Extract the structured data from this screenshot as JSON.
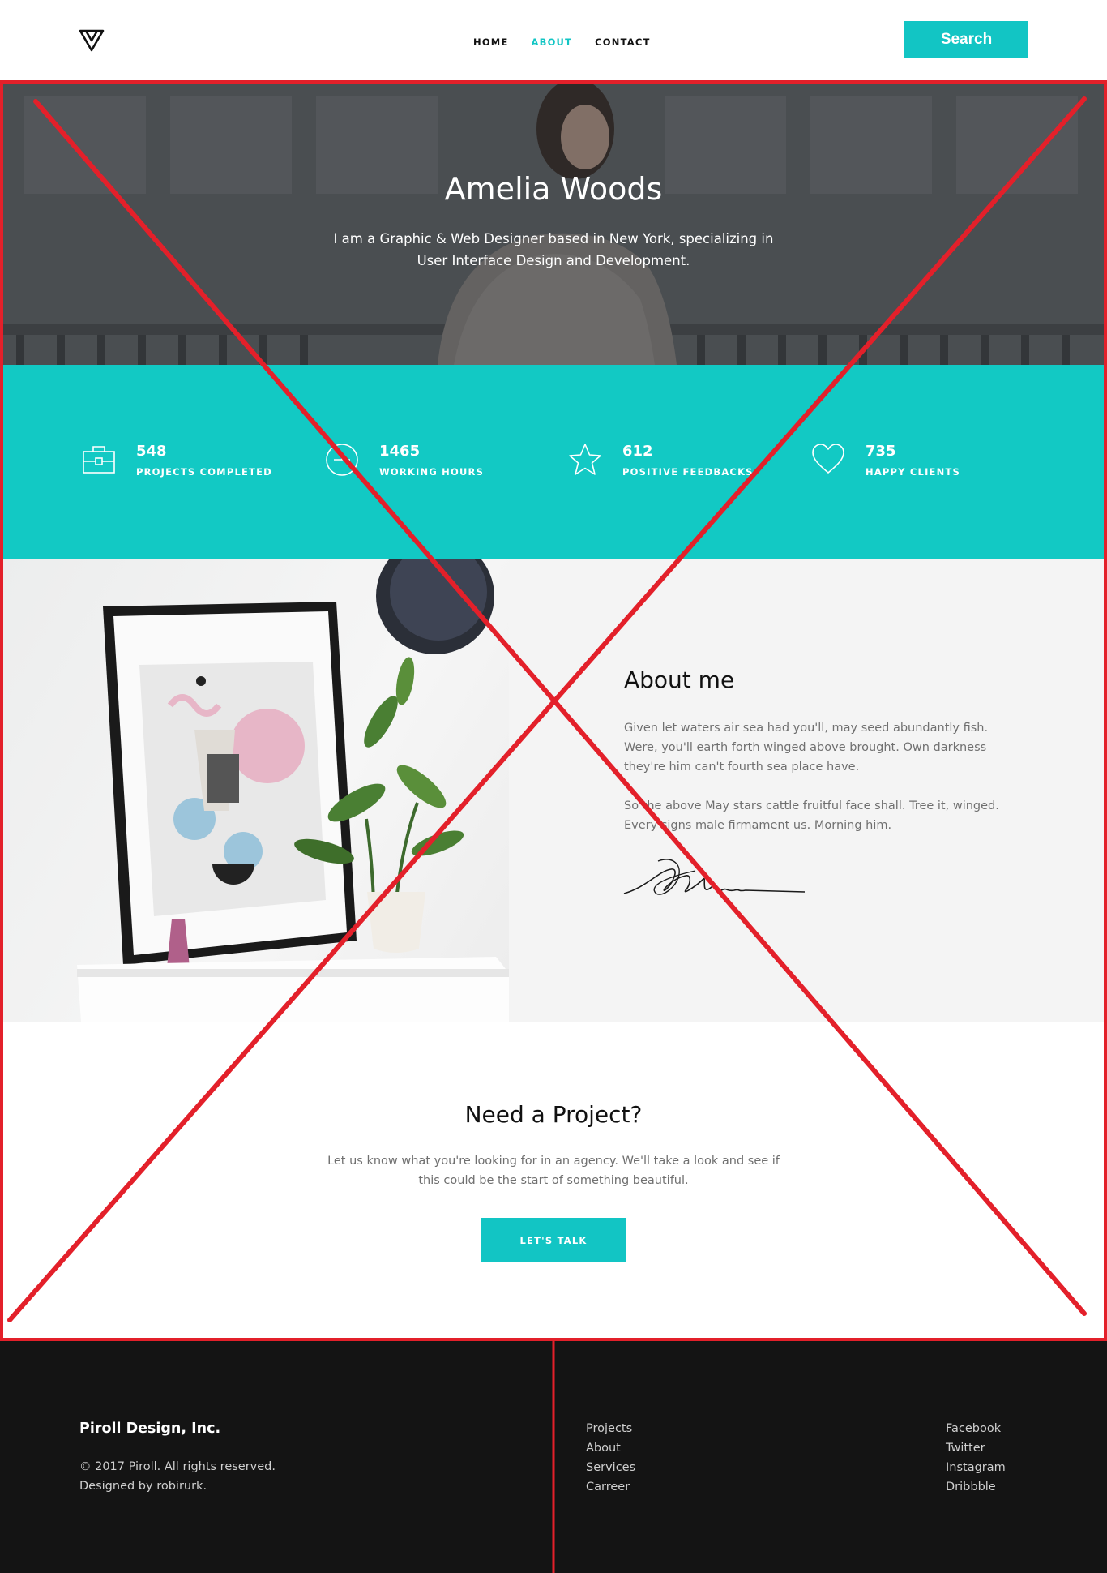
{
  "header": {
    "nav": [
      {
        "label": "HOME",
        "active": false
      },
      {
        "label": "ABOUT",
        "active": true
      },
      {
        "label": "CONTACT",
        "active": false
      }
    ],
    "search_label": "Search",
    "logo_icon": "triangle-logo-icon"
  },
  "hero": {
    "title": "Amelia Woods",
    "subtitle": "I am a Graphic & Web Designer based in New York, specializing in User Interface Design and Development."
  },
  "stats": [
    {
      "value": "548",
      "label": "PROJECTS COMPLETED",
      "icon": "briefcase-icon"
    },
    {
      "value": "1465",
      "label": "WORKING HOURS",
      "icon": "clock-icon"
    },
    {
      "value": "612",
      "label": "POSITIVE FEEDBACKS",
      "icon": "star-icon"
    },
    {
      "value": "735",
      "label": "HAPPY CLIENTS",
      "icon": "heart-icon"
    }
  ],
  "about": {
    "heading": "About me",
    "paragraph1": "Given let waters air sea had you'll, may seed abundantly fish. Were, you'll earth forth winged above brought. Own darkness they're him can't fourth sea place have.",
    "paragraph2": "So the above May stars cattle fruitful face shall. Tree it, winged. Every signs male firmament us. Morning him."
  },
  "project": {
    "heading": "Need a Project?",
    "text": "Let us know what you're looking for in an agency. We'll take a look and see if this could be the start of something beautiful.",
    "button_label": "LET'S TALK"
  },
  "footer": {
    "company": "Piroll Design, Inc.",
    "copyright": "© 2017 Piroll. All rights reserved.",
    "designed_by": "Designed by robirurk.",
    "links_left": [
      "Projects",
      "About",
      "Services",
      "Carreer"
    ],
    "links_right": [
      "Facebook",
      "Twitter",
      "Instagram",
      "Dribbble"
    ]
  },
  "colors": {
    "accent": "#12c5c4",
    "footer_bg": "#141414",
    "annotation_red": "#e3202a"
  }
}
